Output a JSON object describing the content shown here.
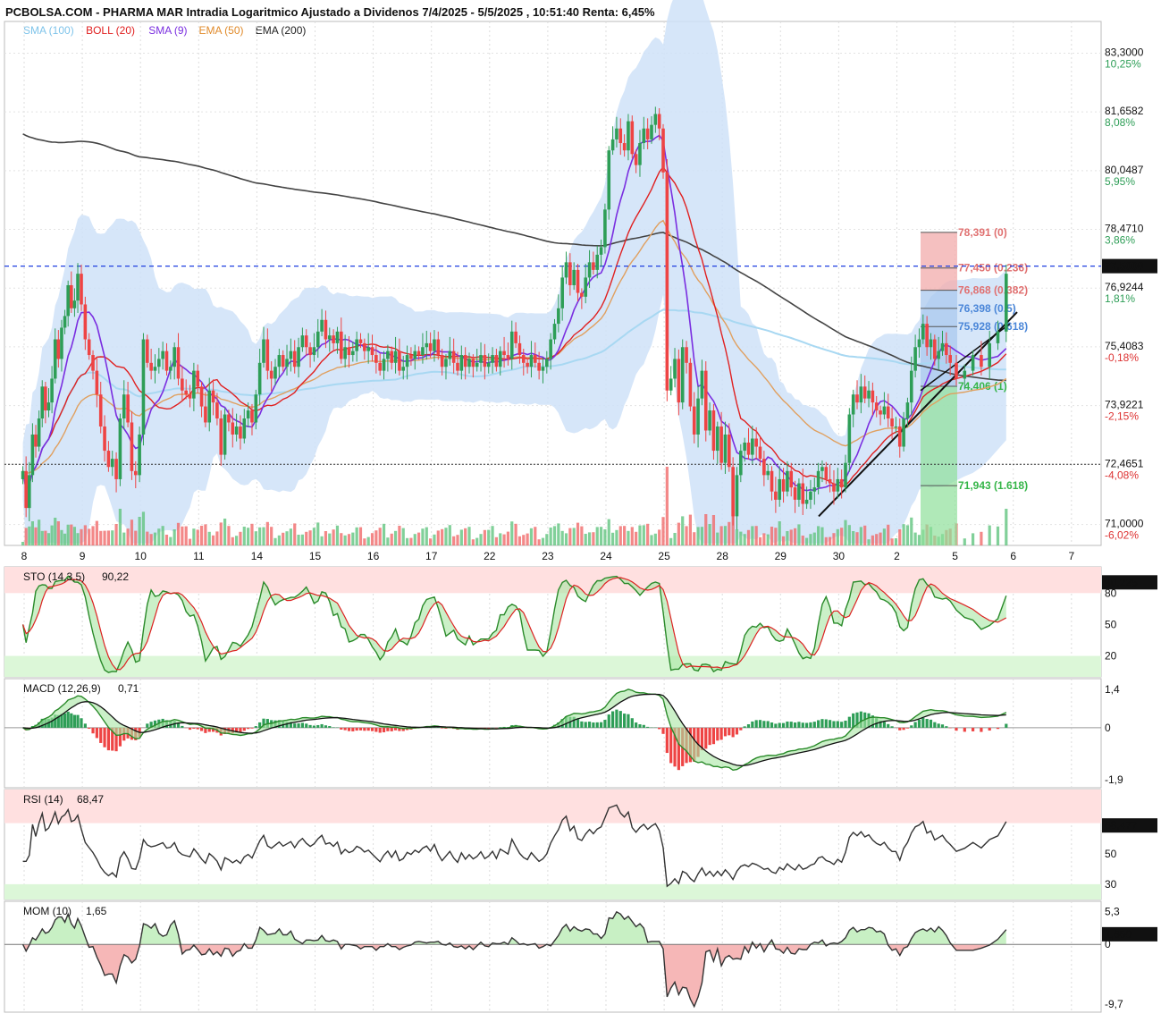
{
  "title": "PCBOLSA.COM - PHARMA MAR Intradia Logaritmico Ajustado a Dividenos 7/4/2025 - 5/5/2025 , 10:51:40 Renta: 6,45%",
  "legend": [
    {
      "text": "SMA (100)",
      "color": "#7fc4ea"
    },
    {
      "text": "BOLL (20)",
      "color": "#e02020"
    },
    {
      "text": "SMA (9)",
      "color": "#7a2ee0"
    },
    {
      "text": "EMA (50)",
      "color": "#e08a2a"
    },
    {
      "text": "EMA (200)",
      "color": "#222222"
    }
  ],
  "colors": {
    "up": "#2e9e57",
    "down": "#ee4444",
    "boll_fill": "#cfe2f8",
    "sma100": "#a8d8f2",
    "boll_mid": "#e02020",
    "sma9": "#7a2ee0",
    "ema50": "#e0a060",
    "ema200": "#444444",
    "current": "#1f3fe0"
  },
  "chart_data": [
    {
      "type": "candlestick",
      "name": "price",
      "scale": "log",
      "ylim": [
        70.5,
        84.2
      ],
      "x_labels": [
        "8",
        "9",
        "10",
        "11",
        "14",
        "15",
        "16",
        "17",
        "22",
        "23",
        "24",
        "25",
        "28",
        "29",
        "30",
        "2",
        "5",
        "6",
        "7"
      ],
      "x_label_session_index": [
        0,
        1,
        2,
        3,
        4,
        5,
        6,
        7,
        8,
        9,
        10,
        11,
        12,
        13,
        14,
        15,
        16,
        17,
        18
      ],
      "y_ticks": [
        {
          "value": 83.3,
          "label": "83,3000",
          "pct": "10,25%"
        },
        {
          "value": 81.6582,
          "label": "81,6582",
          "pct": "8,08%"
        },
        {
          "value": 80.0487,
          "label": "80,0487",
          "pct": "5,95%"
        },
        {
          "value": 78.471,
          "label": "78,4710",
          "pct": "3,86%"
        },
        {
          "value": 76.9244,
          "label": "76,9244",
          "pct": "1,81%"
        },
        {
          "value": 75.4083,
          "label": "75,4083",
          "pct": "-0,18%"
        },
        {
          "value": 73.9221,
          "label": "73,9221",
          "pct": "-2,15%"
        },
        {
          "value": 72.4651,
          "label": "72,4651",
          "pct": "-4,08%"
        },
        {
          "value": 71.0,
          "label": "71,0000",
          "pct": "-6,02%"
        }
      ],
      "current_price": {
        "value": 77.5,
        "label": "77,5000"
      },
      "reference_price": 72.4651,
      "fibonacci": [
        {
          "value": 78.391,
          "label": "78,391 (0)"
        },
        {
          "value": 77.45,
          "label": "77,450 (0.236)"
        },
        {
          "value": 76.868,
          "label": "76,868 (0.382)"
        },
        {
          "value": 76.398,
          "label": "76,398 (0.5)"
        },
        {
          "value": 75.928,
          "label": "75,928 (0.618)"
        },
        {
          "value": 74.406,
          "label": "74,406 (1)"
        },
        {
          "value": 71.943,
          "label": "71,943 (1.618)"
        }
      ],
      "sessions": [
        {
          "label": "8",
          "closes": [
            72.3,
            71.4,
            72.2,
            73.2,
            72.9,
            73.6,
            74.4,
            73.8,
            74.0,
            74.6,
            75.6,
            75.1,
            75.9,
            76.2,
            77.0,
            76.4,
            76.6,
            77.3
          ]
        },
        {
          "label": "9",
          "closes": [
            76.5,
            75.6,
            75.2,
            74.8,
            74.2,
            73.4,
            72.8,
            72.4,
            72.6,
            72.1,
            73.6,
            74.2,
            73.5,
            72.3,
            72.2
          ]
        },
        {
          "label": "10",
          "closes": [
            73.2,
            75.6,
            75.0,
            74.8,
            74.9,
            75.1,
            75.3,
            74.8,
            74.9,
            75.4,
            74.6,
            74.3,
            74.2,
            74.1,
            74.8
          ]
        },
        {
          "label": "11",
          "closes": [
            74.4,
            73.9,
            73.5,
            74.3,
            74.0,
            73.6,
            72.7,
            73.7,
            73.5,
            73.2,
            73.4,
            73.1,
            73.6,
            73.8,
            73.5
          ]
        },
        {
          "label": "14",
          "closes": [
            74.2,
            75.0,
            75.6,
            74.8,
            74.6,
            74.9,
            75.2,
            74.9,
            75.1,
            75.3,
            74.9,
            75.4,
            75.7,
            75.4,
            75.2
          ]
        },
        {
          "label": "15",
          "closes": [
            75.4,
            75.8,
            76.1,
            75.6,
            75.7,
            75.5,
            75.8,
            75.1,
            75.4,
            75.2,
            75.3,
            75.6,
            75.5,
            75.3,
            75.4
          ]
        },
        {
          "label": "16",
          "closes": [
            75.2,
            75.0,
            74.8,
            75.1,
            75.3,
            75.0,
            75.3,
            74.8,
            74.9,
            75.2,
            75.1,
            75.3,
            75.2,
            75.4,
            75.5
          ]
        },
        {
          "label": "17",
          "closes": [
            75.3,
            75.6,
            75.2,
            74.9,
            75.1,
            75.3,
            75.0,
            74.8,
            75.2,
            74.9,
            75.1,
            74.9,
            75.0,
            75.2,
            74.9
          ]
        },
        {
          "label": "22",
          "closes": [
            75.0,
            75.2,
            74.9,
            75.3,
            75.2,
            75.1,
            75.8,
            75.5,
            75.2,
            75.0,
            74.9,
            75.2,
            75.0,
            74.8,
            74.9
          ]
        },
        {
          "label": "23",
          "closes": [
            75.1,
            75.6,
            76.0,
            76.4,
            77.2,
            77.6,
            77.0,
            77.4,
            76.8,
            76.7,
            77.2,
            77.6,
            77.4,
            77.8,
            78.0
          ]
        },
        {
          "label": "24",
          "closes": [
            79.0,
            80.6,
            80.9,
            81.2,
            80.8,
            80.6,
            81.4,
            80.5,
            80.2,
            80.8,
            81.2,
            80.9,
            81.3,
            81.6,
            81.2
          ]
        },
        {
          "label": "25",
          "closes": [
            80.0,
            74.3,
            74.6,
            75.1,
            74.0,
            75.4,
            75.0,
            73.9,
            73.2,
            74.1,
            74.8,
            73.3,
            73.8,
            72.8,
            73.4
          ]
        },
        {
          "label": "28",
          "closes": [
            72.5,
            73.2,
            72.4,
            71.2,
            72.2,
            72.8,
            73.0,
            72.7,
            73.1,
            72.9,
            72.6,
            72.2,
            72.3,
            71.8,
            71.6
          ]
        },
        {
          "label": "29",
          "closes": [
            72.1,
            71.8,
            72.3,
            71.9,
            71.6,
            72.0,
            71.5,
            71.6,
            71.8,
            71.9,
            72.3,
            72.4,
            72.1,
            72.0,
            71.8
          ]
        },
        {
          "label": "30",
          "closes": [
            72.1,
            71.9,
            72.5,
            73.7,
            74.2,
            74.0,
            74.4,
            74.1,
            74.3,
            74.0,
            73.8,
            73.7,
            73.9,
            73.6,
            73.4
          ]
        },
        {
          "label": "2",
          "closes": [
            73.4,
            72.9,
            73.6,
            74.0,
            74.8,
            75.4,
            75.6,
            76.0,
            75.4,
            75.6,
            75.1,
            75.3,
            75.5,
            75.2,
            75.0
          ]
        },
        {
          "label": "5",
          "closes": [
            74.6,
            74.8,
            75.2,
            74.9,
            75.5,
            75.8,
            77.3
          ]
        }
      ]
    },
    {
      "type": "line",
      "name": "STO",
      "title": "STO (14,3,5)",
      "value_label": "90,22",
      "ylim": [
        0,
        105
      ],
      "levels": [
        {
          "value": 80,
          "label": "80"
        },
        {
          "value": 50,
          "label": "50"
        },
        {
          "value": 20,
          "label": "20"
        }
      ],
      "current": {
        "value": 90.225,
        "label": "90,225"
      }
    },
    {
      "type": "line",
      "name": "MACD",
      "title": "MACD (12,26,9)",
      "value_label": "0,71",
      "ylim": [
        -2.2,
        1.8
      ],
      "levels": [
        {
          "value": 1.4,
          "label": "1,4",
          "color": "#cc2222"
        },
        {
          "value": 0,
          "label": "0",
          "color": "#111"
        },
        {
          "value": -1.9,
          "label": "-1,9",
          "color": "#2a7a3a"
        }
      ]
    },
    {
      "type": "line",
      "name": "RSI",
      "title": "RSI (14)",
      "value_label": "68,47",
      "ylim": [
        20,
        92
      ],
      "levels": [
        {
          "value": 70,
          "label": ""
        },
        {
          "value": 50,
          "label": "50"
        },
        {
          "value": 30,
          "label": "30"
        }
      ],
      "current": {
        "value": 68.477,
        "label": "68,477"
      }
    },
    {
      "type": "line",
      "name": "MOM",
      "title": "MOM (10)",
      "value_label": "1,65",
      "ylim": [
        -11,
        7
      ],
      "levels": [
        {
          "value": 5.3,
          "label": "5,3",
          "color": "#cc2222"
        },
        {
          "value": 0,
          "label": "0",
          "color": "#111"
        },
        {
          "value": -9.7,
          "label": "-9,7",
          "color": "#2a7a3a"
        }
      ],
      "current": {
        "value": 1.65,
        "label": "1,650"
      }
    }
  ]
}
